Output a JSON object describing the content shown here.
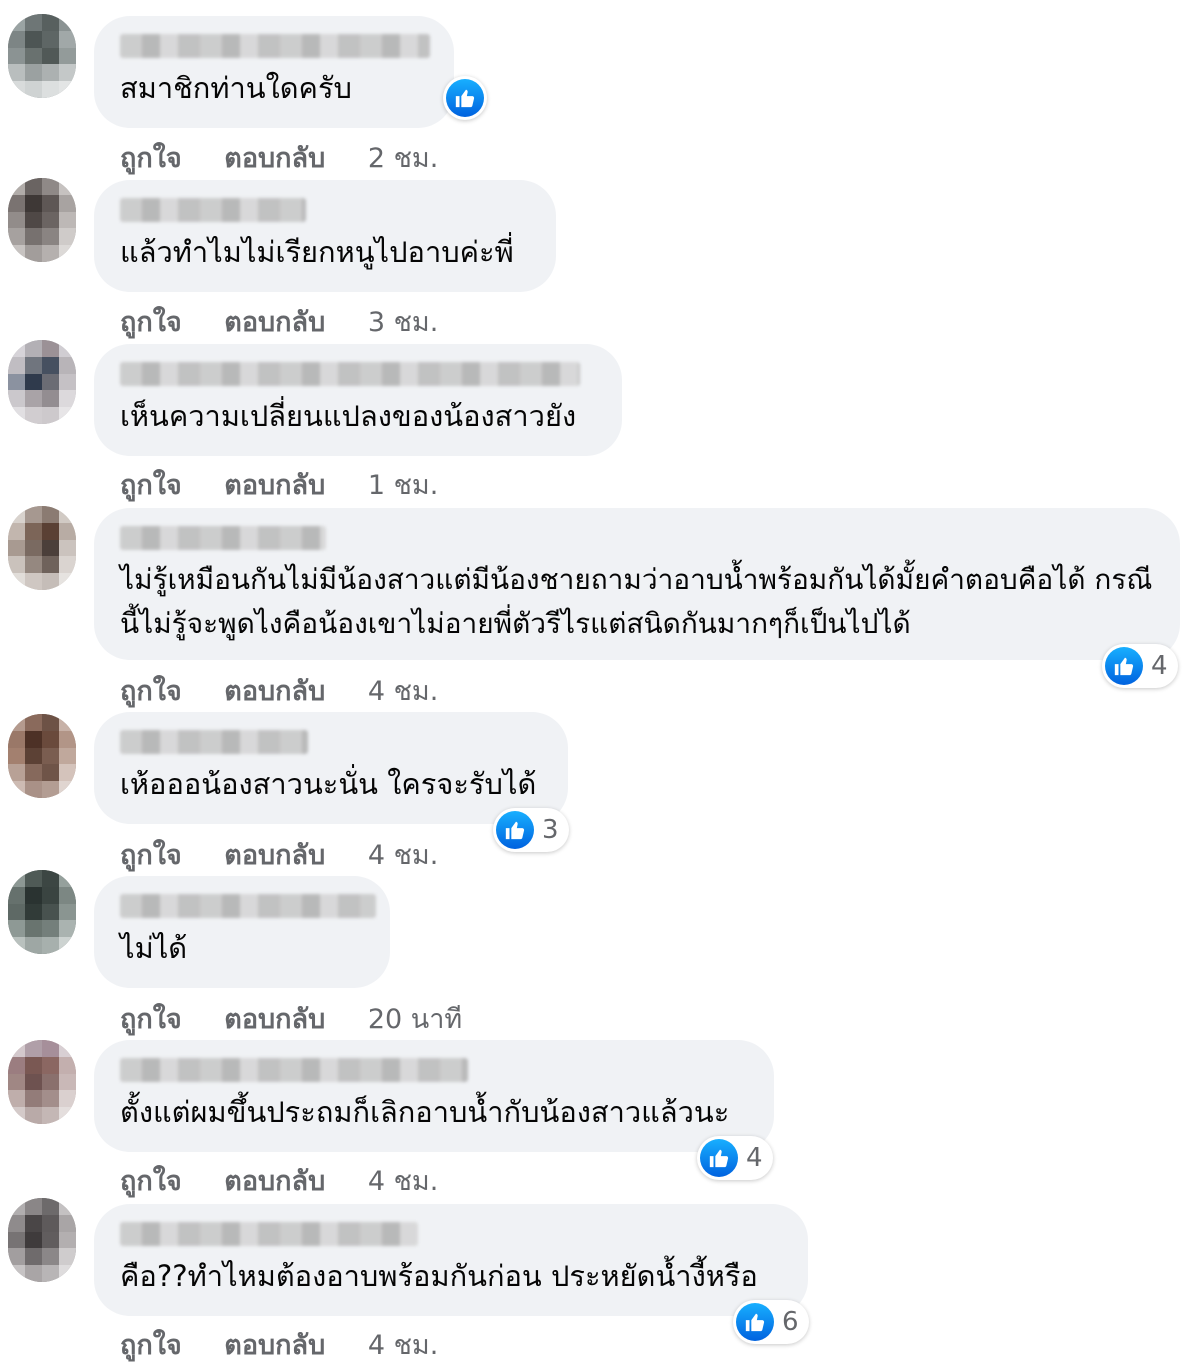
{
  "actions": {
    "like": "ถูกใจ",
    "reply": "ตอบกลับ"
  },
  "colors": {
    "like_blue": "#1877f2",
    "bubble": "#f0f2f5",
    "meta": "#65676b"
  },
  "comments": [
    {
      "text": "สมาชิกท่านใดครับ",
      "time": "2 ชม.",
      "likes": ""
    },
    {
      "text": "แล้วทำไมไม่เรียกหนูไปอาบค่ะพี่",
      "time": "3 ชม.",
      "likes": ""
    },
    {
      "text": "เห็นความเปลี่ยนแปลงของน้องสาวยัง",
      "time": "1 ชม.",
      "likes": ""
    },
    {
      "text": "ไม่รู้เหมือนกันไม่มีน้องสาวแต่มีน้องชายถามว่าอาบน้ำพร้อมกันได้มั้ยคำตอบคือได้ กรณีนี้ไม่รู้จะพูดไงคือน้องเขาไม่อายพี่ตัวรีไรแต่สนิดกันมากๆก็เป็นไปได้",
      "time": "4 ชม.",
      "likes": "4"
    },
    {
      "text": "เห้อออน้องสาวนะนั่น ใครจะรับได้",
      "time": "4 ชม.",
      "likes": "3"
    },
    {
      "text": "ไม่ได้",
      "time": "20 นาที",
      "likes": ""
    },
    {
      "text": "ตั้งแต่ผมขึ้นประถมก็เลิกอาบน้ำกับน้องสาวแล้วนะ",
      "time": "4 ชม.",
      "likes": "4"
    },
    {
      "text": "คือ??ทำไหมต้องอาบพร้อมกันก่อน ประหยัดน้ำงี้หรือ",
      "time": "4 ชม.",
      "likes": "6"
    }
  ]
}
